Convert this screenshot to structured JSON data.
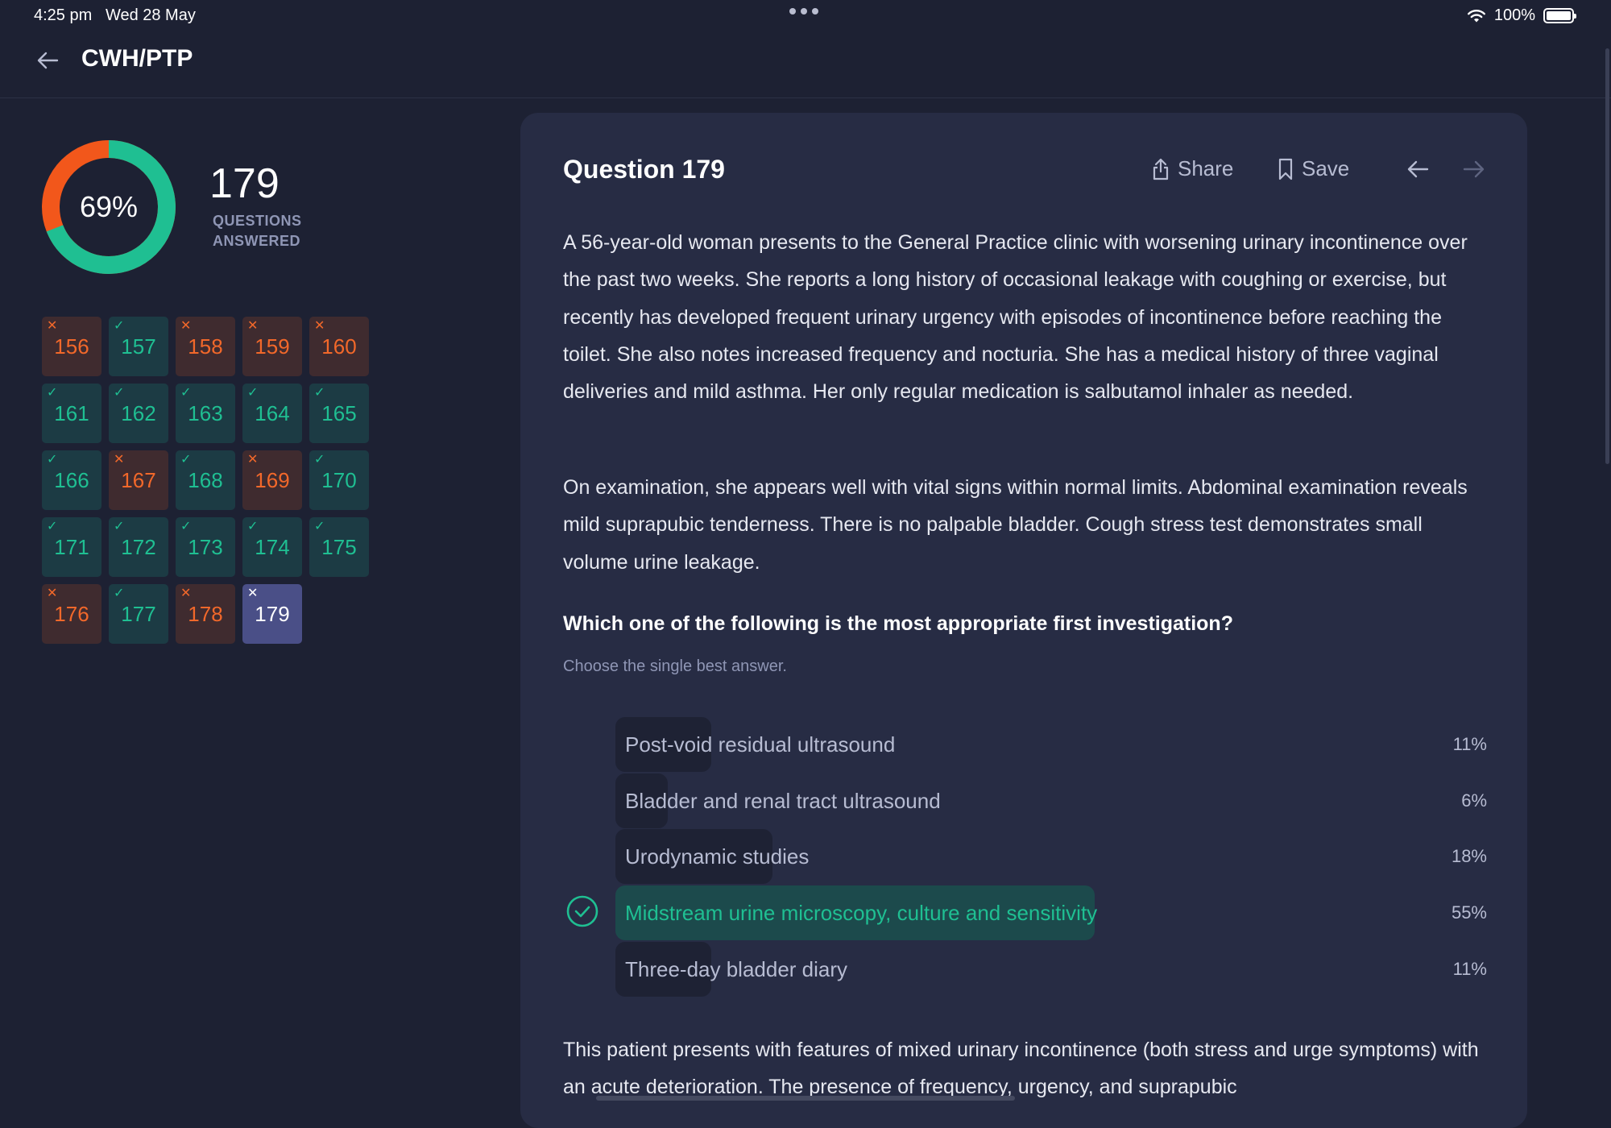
{
  "status_bar": {
    "time": "4:25 pm",
    "date": "Wed 28 May",
    "battery": "100%"
  },
  "header": {
    "title": "CWH/PTP"
  },
  "stats": {
    "percent_label": "69%",
    "percent": 69,
    "answered_count": "179",
    "answered_label": "QUESTIONS ANSWERED"
  },
  "colors": {
    "correct": "#1fbf92",
    "wrong": "#f2682a",
    "current": "#4a4f87",
    "background": "#1d2133",
    "card": "#272c44"
  },
  "questions": [
    {
      "num": "156",
      "status": "wrong"
    },
    {
      "num": "157",
      "status": "correct"
    },
    {
      "num": "158",
      "status": "wrong"
    },
    {
      "num": "159",
      "status": "wrong"
    },
    {
      "num": "160",
      "status": "wrong"
    },
    {
      "num": "161",
      "status": "correct"
    },
    {
      "num": "162",
      "status": "correct"
    },
    {
      "num": "163",
      "status": "correct"
    },
    {
      "num": "164",
      "status": "correct"
    },
    {
      "num": "165",
      "status": "correct"
    },
    {
      "num": "166",
      "status": "correct"
    },
    {
      "num": "167",
      "status": "wrong"
    },
    {
      "num": "168",
      "status": "correct"
    },
    {
      "num": "169",
      "status": "wrong"
    },
    {
      "num": "170",
      "status": "correct"
    },
    {
      "num": "171",
      "status": "correct"
    },
    {
      "num": "172",
      "status": "correct"
    },
    {
      "num": "173",
      "status": "correct"
    },
    {
      "num": "174",
      "status": "correct"
    },
    {
      "num": "175",
      "status": "correct"
    },
    {
      "num": "176",
      "status": "wrong"
    },
    {
      "num": "177",
      "status": "correct"
    },
    {
      "num": "178",
      "status": "wrong"
    },
    {
      "num": "179",
      "status": "current"
    }
  ],
  "question": {
    "title": "Question 179",
    "share_label": "Share",
    "save_label": "Save",
    "paragraph1": "A 56-year-old woman presents to the General Practice clinic with worsening urinary incontinence over the past two weeks. She reports a long history of occasional leakage with coughing or exercise, but recently has developed frequent urinary urgency with episodes of incontinence before reaching the toilet. She also notes increased frequency and nocturia. She has a medical history of three vaginal deliveries and mild asthma. Her only regular medication is salbutamol inhaler as needed.",
    "paragraph2": "On examination, she appears well with vital signs within normal limits. Abdominal examination reveals mild suprapubic tenderness. There is no palpable bladder. Cough stress test demonstrates small volume urine leakage.",
    "prompt": "Which one of the following is the most appropriate first investigation?",
    "hint": "Choose the single best answer.",
    "options": [
      {
        "label": "Post-void residual ultrasound",
        "percent_label": "11%",
        "percent": 11,
        "selected": false
      },
      {
        "label": "Bladder and renal tract ultrasound",
        "percent_label": "6%",
        "percent": 6,
        "selected": false
      },
      {
        "label": "Urodynamic studies",
        "percent_label": "18%",
        "percent": 18,
        "selected": false
      },
      {
        "label": "Midstream urine microscopy, culture and sensitivity",
        "percent_label": "55%",
        "percent": 55,
        "selected": true
      },
      {
        "label": "Three-day bladder diary",
        "percent_label": "11%",
        "percent": 11,
        "selected": false
      }
    ],
    "explanation": "This patient presents with features of mixed urinary incontinence (both stress and urge symptoms) with an acute deterioration. The presence of frequency, urgency, and suprapubic"
  }
}
